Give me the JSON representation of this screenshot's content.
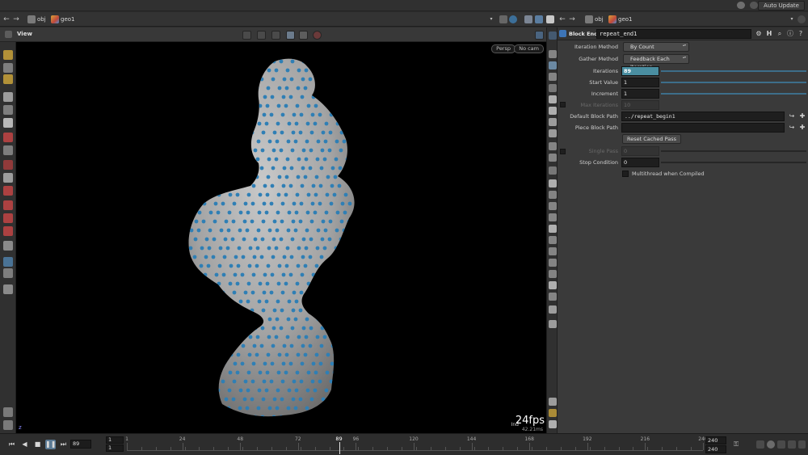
{
  "menubar": {
    "auto_update": "Auto Update"
  },
  "left_path": {
    "back": "←",
    "forward": "→",
    "context": "obj",
    "node": "geo1"
  },
  "right_path": {
    "back": "←",
    "forward": "→",
    "context": "obj",
    "node": "geo1"
  },
  "viewport": {
    "title": "View",
    "persp_label": "Persp",
    "cam_label": "No cam",
    "fps": "24fps",
    "ind_label": "Ind",
    "ms_label": "42.21ms",
    "axis_label": "z"
  },
  "param_panel": {
    "node_type": "Block End",
    "node_name": "repeat_end1",
    "parameters": {
      "iteration_method": {
        "label": "Iteration Method",
        "value": "By Count"
      },
      "gather_method": {
        "label": "Gather Method",
        "value": "Feedback Each Iteration"
      },
      "iterations": {
        "label": "Iterations",
        "value": "89"
      },
      "start_value": {
        "label": "Start Value",
        "value": "1"
      },
      "increment": {
        "label": "Increment",
        "value": "1"
      },
      "max_iterations": {
        "label": "Max Iterations",
        "value": "10"
      },
      "default_block_path": {
        "label": "Default Block Path",
        "value": "../repeat_begin1"
      },
      "piece_block_path": {
        "label": "Piece Block Path",
        "value": ""
      },
      "reset_cached_pass": {
        "label": "Reset Cached Pass"
      },
      "single_pass": {
        "label": "Single Pass",
        "value": "0"
      },
      "stop_condition": {
        "label": "Stop Condition",
        "value": "0"
      },
      "multithread": {
        "label": "Multithread when Compiled"
      }
    }
  },
  "timeline": {
    "current_frame": "89",
    "start_a": "1",
    "start_b": "1",
    "end_a": "240",
    "end_b": "240",
    "ticks": [
      "1",
      "24",
      "48",
      "72",
      "96",
      "120",
      "144",
      "168",
      "192",
      "216",
      "240"
    ],
    "cursor_label": "89"
  },
  "colors": {
    "accent": "#4a8ea1",
    "point": "#2f7fb5",
    "mesh": "#9a9a9a",
    "viewport_bg": "#000000"
  },
  "icons": {
    "playback": [
      "first-frame-icon",
      "play-reverse-icon",
      "stop-icon",
      "play-icon",
      "last-frame-icon"
    ]
  }
}
